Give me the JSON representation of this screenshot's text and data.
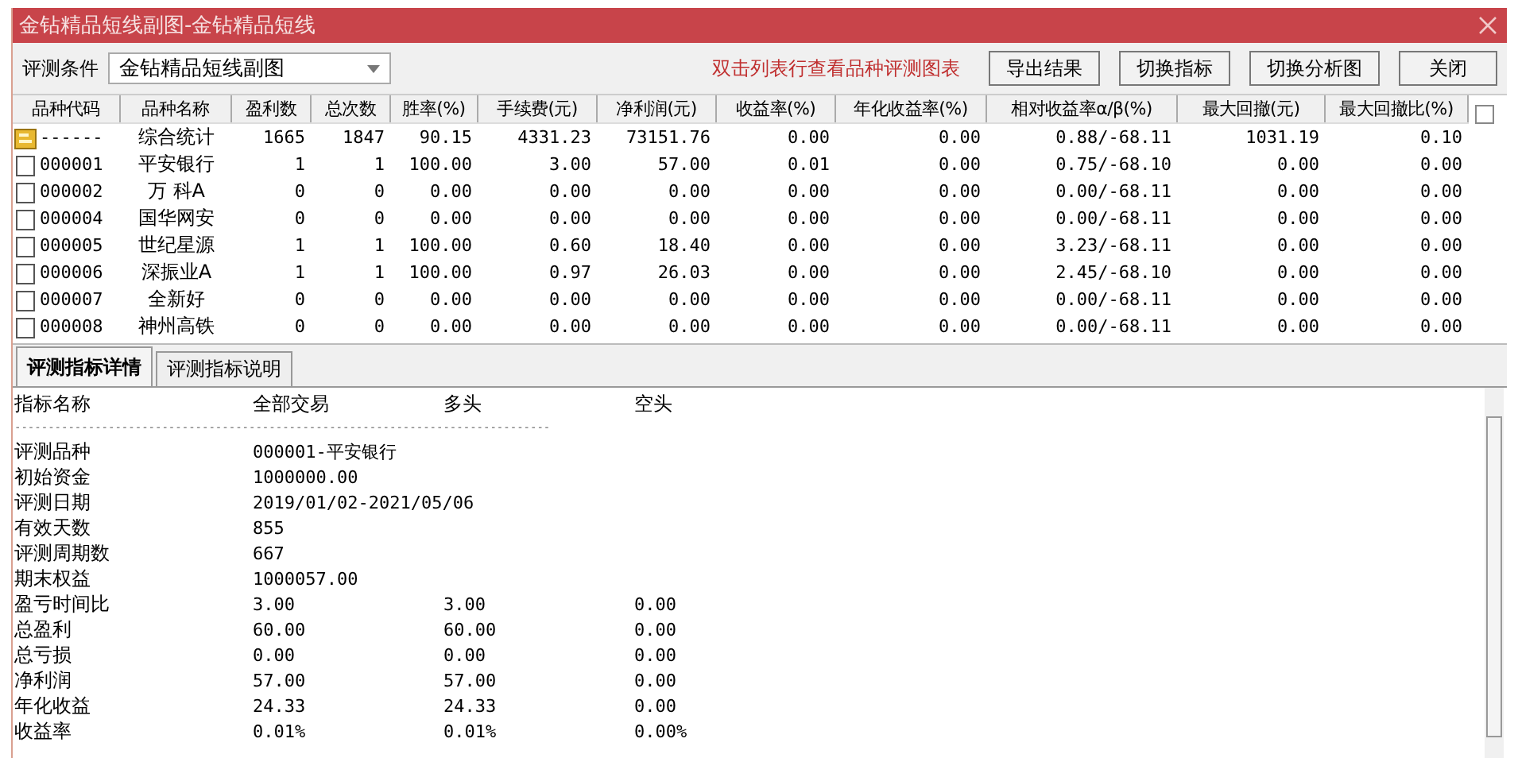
{
  "window": {
    "title": "金钻精品短线副图-金钻精品短线"
  },
  "toolbar": {
    "condition_label": "评测条件",
    "condition_value": "金钻精品短线副图",
    "hint": "双击列表行查看品种评测图表",
    "buttons": [
      "导出结果",
      "切换指标",
      "切换分析图",
      "关闭"
    ]
  },
  "table": {
    "checkbox": {
      "checked": false
    },
    "columns": [
      "品种代码",
      "品种名称",
      "盈利数",
      "总次数",
      "胜率(%)",
      "手续费(元)",
      "净利润(元)",
      "收益率(%)",
      "年化收益率(%)",
      "相对收益率α/β(%)",
      "最大回撤(元)",
      "最大回撤比(%)"
    ],
    "rows": [
      {
        "kind": "summary",
        "cells": [
          "------",
          "综合统计",
          "1665",
          "1847",
          "90.15",
          "4331.23",
          "73151.76",
          "0.00",
          "0.00",
          "0.88/-68.11",
          "1031.19",
          "0.10"
        ]
      },
      {
        "kind": "item",
        "cells": [
          "000001",
          "平安银行",
          "1",
          "1",
          "100.00",
          "3.00",
          "57.00",
          "0.01",
          "0.00",
          "0.75/-68.10",
          "0.00",
          "0.00"
        ]
      },
      {
        "kind": "item",
        "cells": [
          "000002",
          "万 科A",
          "0",
          "0",
          "0.00",
          "0.00",
          "0.00",
          "0.00",
          "0.00",
          "0.00/-68.11",
          "0.00",
          "0.00"
        ]
      },
      {
        "kind": "item",
        "cells": [
          "000004",
          "国华网安",
          "0",
          "0",
          "0.00",
          "0.00",
          "0.00",
          "0.00",
          "0.00",
          "0.00/-68.11",
          "0.00",
          "0.00"
        ]
      },
      {
        "kind": "item",
        "cells": [
          "000005",
          "世纪星源",
          "1",
          "1",
          "100.00",
          "0.60",
          "18.40",
          "0.00",
          "0.00",
          "3.23/-68.11",
          "0.00",
          "0.00"
        ]
      },
      {
        "kind": "item",
        "cells": [
          "000006",
          "深振业A",
          "1",
          "1",
          "100.00",
          "0.97",
          "26.03",
          "0.00",
          "0.00",
          "2.45/-68.10",
          "0.00",
          "0.00"
        ]
      },
      {
        "kind": "item",
        "cells": [
          "000007",
          "全新好",
          "0",
          "0",
          "0.00",
          "0.00",
          "0.00",
          "0.00",
          "0.00",
          "0.00/-68.11",
          "0.00",
          "0.00"
        ]
      },
      {
        "kind": "item",
        "cells": [
          "000008",
          "神州高铁",
          "0",
          "0",
          "0.00",
          "0.00",
          "0.00",
          "0.00",
          "0.00",
          "0.00/-68.11",
          "0.00",
          "0.00"
        ]
      }
    ]
  },
  "tabs": [
    {
      "label": "评测指标详情",
      "selected": true
    },
    {
      "label": "评测指标说明",
      "selected": false
    }
  ],
  "detail": {
    "columns": [
      "指标名称",
      "全部交易",
      "多头",
      "空头"
    ],
    "separator": "--------------------------------------------------------------------------------",
    "rows": [
      [
        "评测品种",
        "000001-平安银行",
        "",
        ""
      ],
      [
        "初始资金",
        "1000000.00",
        "",
        ""
      ],
      [
        "评测日期",
        "2019/01/02-2021/05/06",
        "",
        ""
      ],
      [
        "有效天数",
        "855",
        "",
        ""
      ],
      [
        "评测周期数",
        "667",
        "",
        ""
      ],
      [
        "期末权益",
        "1000057.00",
        "",
        ""
      ],
      [
        "盈亏时间比",
        "3.00",
        "3.00",
        "0.00"
      ],
      [
        "总盈利",
        "60.00",
        "60.00",
        "0.00"
      ],
      [
        "总亏损",
        "0.00",
        "0.00",
        "0.00"
      ],
      [
        "净利润",
        "57.00",
        "57.00",
        "0.00"
      ],
      [
        "年化收益",
        "24.33",
        "24.33",
        "0.00"
      ],
      [
        "收益率",
        "0.01%",
        "0.01%",
        "0.00%"
      ]
    ]
  }
}
